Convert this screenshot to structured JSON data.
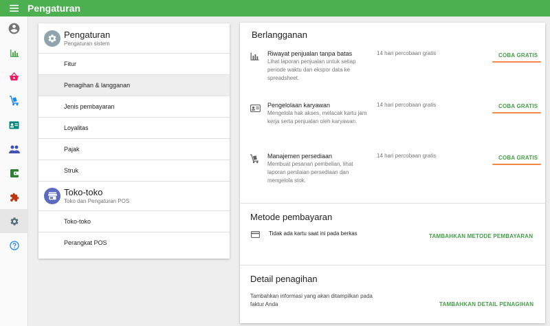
{
  "app": {
    "title": "Pengaturan"
  },
  "left": {
    "settings": {
      "title": "Pengaturan",
      "subtitle": "Pengaturan sistem",
      "items": [
        "Fitur",
        "Penagihan & langganan",
        "Jenis pembayaran",
        "Loyalitas",
        "Pajak",
        "Struk"
      ]
    },
    "stores": {
      "title": "Toko-toko",
      "subtitle": "Toko dan Pengaturan POS",
      "items": [
        "Toko-toko",
        "Perangkat POS"
      ]
    }
  },
  "subscription": {
    "title": "Berlangganan",
    "rows": [
      {
        "icon": "bar-chart-icon",
        "title": "Riwayat penjualan tanpa batas",
        "desc": "Lihat laporan penjualan untuk setiap periode waktu dan ekspor data ke spreadsheet.",
        "trial": "14 hari percobaan gratis",
        "action": "COBA GRATIS"
      },
      {
        "icon": "id-card-icon",
        "title": "Pengelolaan karyawan",
        "desc": "Mengelola hak akses, melacak kartu jam kerja serta penjualan oleh karyawan.",
        "trial": "14 hari percobaan gratis",
        "action": "COBA GRATIS"
      },
      {
        "icon": "dolly-icon",
        "title": "Manajemen persediaan",
        "desc": "Membuat pesanan pembelian, lihat laporan penilaian persediaan dan mengelola stok.",
        "trial": "14 hari percobaan gratis",
        "action": "COBA GRATIS"
      }
    ]
  },
  "payment": {
    "title": "Metode pembayaran",
    "empty": "Tidak ada kartu saat ini pada berkas",
    "action": "TAMBAHKAN METODE PEMBAYARAN"
  },
  "billing": {
    "title": "Detail penagihan",
    "desc": "Tambahkan informasi yang akan ditampilkan pada faktur Anda",
    "action": "TAMBAHKAN DETAIL PENAGIHAN"
  },
  "colors": {
    "brand": "#4caf50",
    "accent": "#43a047",
    "highlight": "#f48742"
  }
}
